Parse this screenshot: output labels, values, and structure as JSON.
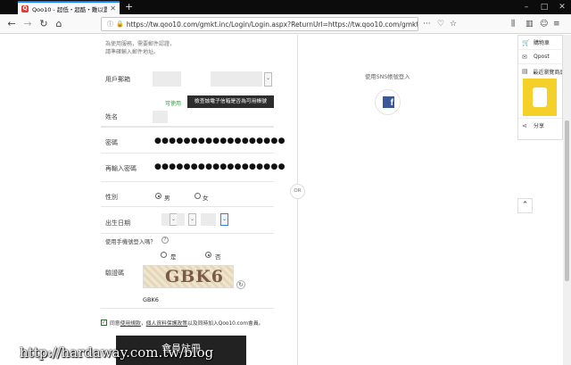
{
  "browser": {
    "tab_title": "Qoo10 - 超低・超酷・難以置信",
    "tab_favicon": "Q",
    "url": "https://tw.qoo10.com/gmkt.inc/Login/Login.aspx?ReturnUrl=https://tw.qoo10.com/gmkt.i"
  },
  "form": {
    "email_note_line1": "為使用服務，需要郵件認證，",
    "email_note_line2": "請準確輸入郵件地址。",
    "email_label": "用戶郵箱",
    "email_status": "可使用",
    "check_email_button": "檢查該電子信箱是否為可用帳號",
    "name_label": "姓名",
    "password_label": "密碼",
    "password_value": "●●●●●●●●●●●●●●●●●●",
    "confirm_label": "再輸入密碼",
    "confirm_value": "●●●●●●●●●●●●●●●●●●",
    "gender_label": "性別",
    "gender_male": "男",
    "gender_female": "女",
    "birthday_label": "出生日期",
    "phone_login_question": "使用手機號登入嗎？",
    "phone_login_yes": "是",
    "phone_login_no": "否",
    "captcha_label": "驗證碼",
    "captcha_image_text": "GBK6",
    "captcha_value": "GBK6",
    "agree_prefix": "同意",
    "agree_terms_link": "使用規款",
    "agree_sep": "，",
    "agree_privacy_link": "個人資料保護政策",
    "agree_suffix": "以及同時加入Qoo10.com會員。",
    "register_button": "會員註冊"
  },
  "right": {
    "sns_label": "使用SNS帳號登入",
    "or_label": "OR"
  },
  "sidebar": {
    "items": [
      {
        "label": "購物車",
        "icon": "cart-icon"
      },
      {
        "label": "Qpost",
        "icon": "mail-icon"
      },
      {
        "label": "最近瀏覽商品",
        "icon": "recent-icon"
      },
      {
        "label": "分享",
        "icon": "share-icon"
      }
    ]
  },
  "watermark": "http://hardaway.com.tw/blog"
}
